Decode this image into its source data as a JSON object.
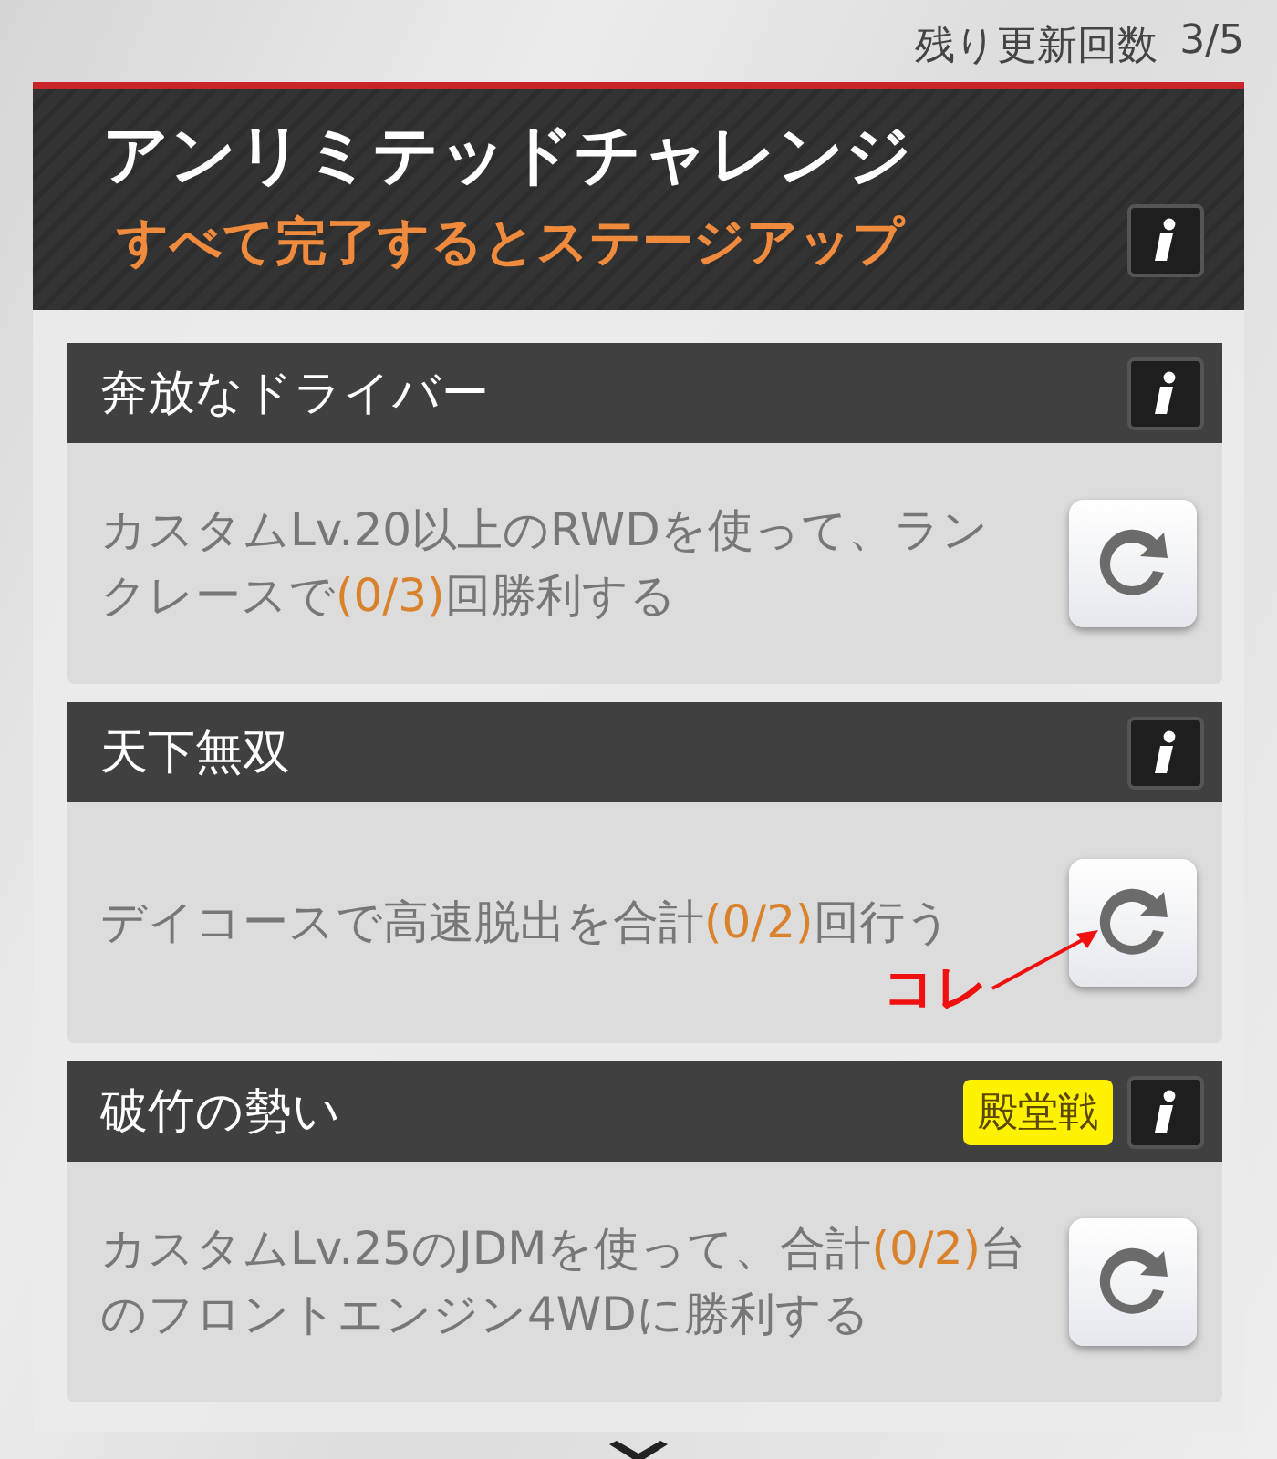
{
  "refresh_count": {
    "label": "残り更新回数",
    "value": "3/5"
  },
  "panel": {
    "title": "アンリミテッドチャレンジ",
    "subtitle": "すべて完了するとステージアップ"
  },
  "missions": [
    {
      "title": "奔放なドライバー",
      "description": [
        {
          "text": "カスタムLv.20以上のRWDを使って、ランクレースで",
          "highlight": false
        },
        {
          "text": "(0/3)",
          "highlight": true
        },
        {
          "text": "回勝利する",
          "highlight": false
        }
      ]
    },
    {
      "title": "天下無双",
      "description": [
        {
          "text": "デイコースで高速脱出を合計",
          "highlight": false
        },
        {
          "text": "(0/2)",
          "highlight": true
        },
        {
          "text": "回行う",
          "highlight": false
        }
      ],
      "annotation": "コレ"
    },
    {
      "title": "破竹の勢い",
      "badge": "殿堂戦",
      "description": [
        {
          "text": "カスタムLv.25のJDMを使って、合計",
          "highlight": false
        },
        {
          "text": "(0/2)",
          "highlight": true
        },
        {
          "text": "台のフロントエンジン4WDに勝利する",
          "highlight": false
        }
      ]
    }
  ]
}
